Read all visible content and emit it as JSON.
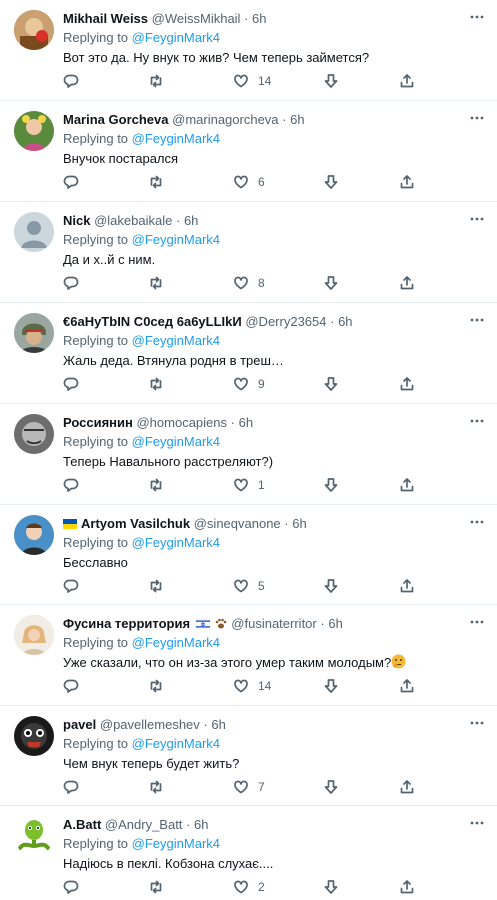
{
  "common": {
    "replying_prefix": "Replying to",
    "replying_to": "@FeyginMark4",
    "dot": "·"
  },
  "tweets": [
    {
      "name": "Mikhail Weiss",
      "handle": "@WeissMikhail",
      "time": "6h",
      "text": "Вот это да. Ну внук то жив? Чем теперь займется?",
      "likes": "14"
    },
    {
      "name": "Marina Gorcheva",
      "handle": "@marinagorcheva",
      "time": "6h",
      "text": "Внучок постарался",
      "likes": "6"
    },
    {
      "name": "Nick",
      "handle": "@lakebaikale",
      "time": "6h",
      "text": "Да и х..й с ним.",
      "likes": "8"
    },
    {
      "name": "€6aHyTbIN C0сед 6a6yLLIkИ",
      "handle": "@Derry23654",
      "time": "6h",
      "text": "Жаль деда. Втянула родня в треш…",
      "likes": "9"
    },
    {
      "name": "Россиянин",
      "handle": "@homocapiens",
      "time": "6h",
      "text": "Теперь Навального расстреляют?)",
      "likes": "1"
    },
    {
      "name": "Artyom Vasilchuk",
      "handle": "@sineqvanone",
      "time": "6h",
      "text": "Бесславно",
      "likes": "5"
    },
    {
      "name": "Фусина территория",
      "handle": "@fusinaterritor",
      "time": "6h",
      "text": "Уже сказали, что он из-за этого умер таким молодым?",
      "likes": "14"
    },
    {
      "name": "pavel",
      "handle": "@pavellemeshev",
      "time": "6h",
      "text": "Чем внук теперь будет жить?",
      "likes": "7"
    },
    {
      "name": "A.Batt",
      "handle": "@Andry_Batt",
      "time": "6h",
      "text": "Надіюсь в пеклі. Кобзона слухає....",
      "likes": "2"
    }
  ],
  "icons": {
    "reply": "reply-icon",
    "retweet": "retweet-icon",
    "like": "heart-icon",
    "vote": "downvote-icon",
    "share": "share-icon",
    "more": "more-icon"
  },
  "colors": {
    "mention": "#1d9bf0",
    "secondary": "#536471",
    "divider": "#e6ecf0"
  }
}
